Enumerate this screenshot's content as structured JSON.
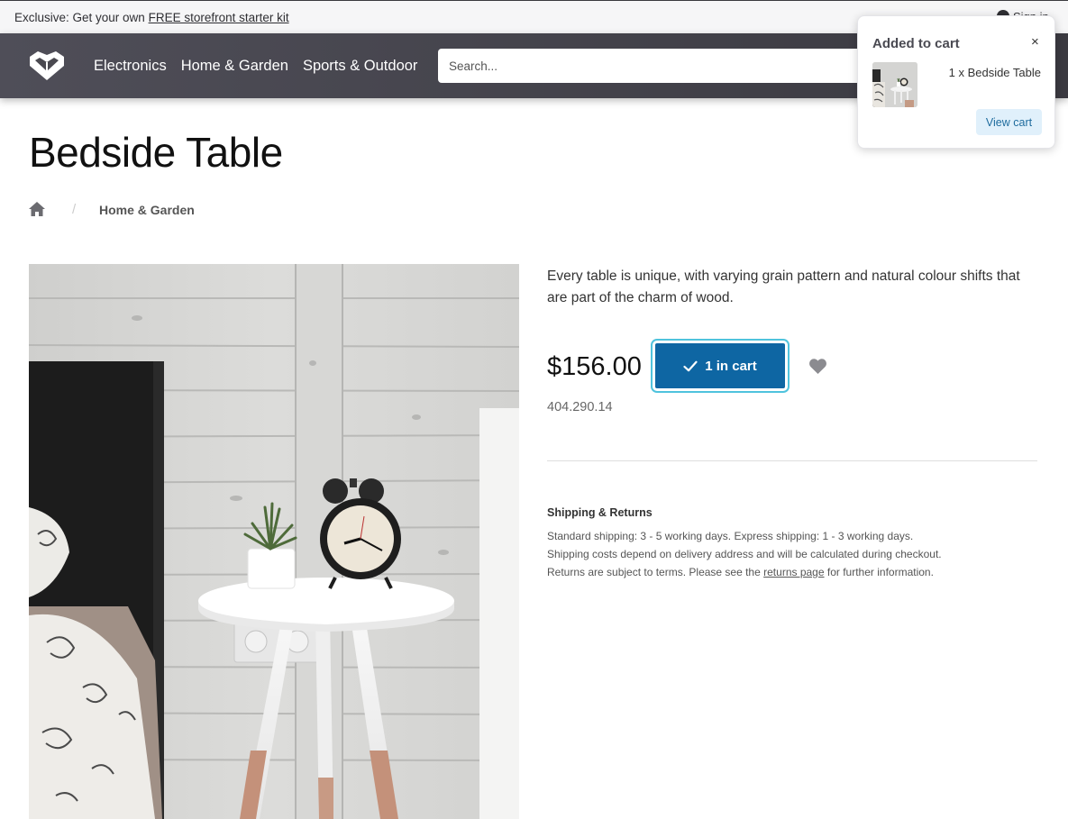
{
  "promo": {
    "prefix": "Exclusive: Get your own",
    "link": "FREE storefront starter kit",
    "signin": "Sign in"
  },
  "nav": {
    "items": [
      "Electronics",
      "Home & Garden",
      "Sports & Outdoor"
    ]
  },
  "search": {
    "placeholder": "Search..."
  },
  "toast": {
    "title": "Added to cart",
    "close": "×",
    "item": "1 x Bedside Table",
    "button": "View cart"
  },
  "product": {
    "title": "Bedside Table",
    "description": "Every table is unique, with varying grain pattern and natural colour shifts that are part of the charm of wood.",
    "price": "$156.00",
    "cart_button": "1 in cart",
    "sku": "404.290.14"
  },
  "breadcrumb": {
    "separator": "/",
    "category": "Home & Garden"
  },
  "shipping": {
    "title": "Shipping & Returns",
    "line1": "Standard shipping: 3 - 5 working days. Express shipping: 1 - 3 working days.",
    "line2": "Shipping costs depend on delivery address and will be calculated during checkout.",
    "line3_prefix": "Returns are subject to terms. Please see the",
    "line3_link": "returns page",
    "line3_suffix": "for further information."
  },
  "colors": {
    "header": "#46454e",
    "primary_button": "#0e66a3",
    "focus_ring": "#4fc3dd",
    "view_cart_bg": "#e0f0fb"
  }
}
